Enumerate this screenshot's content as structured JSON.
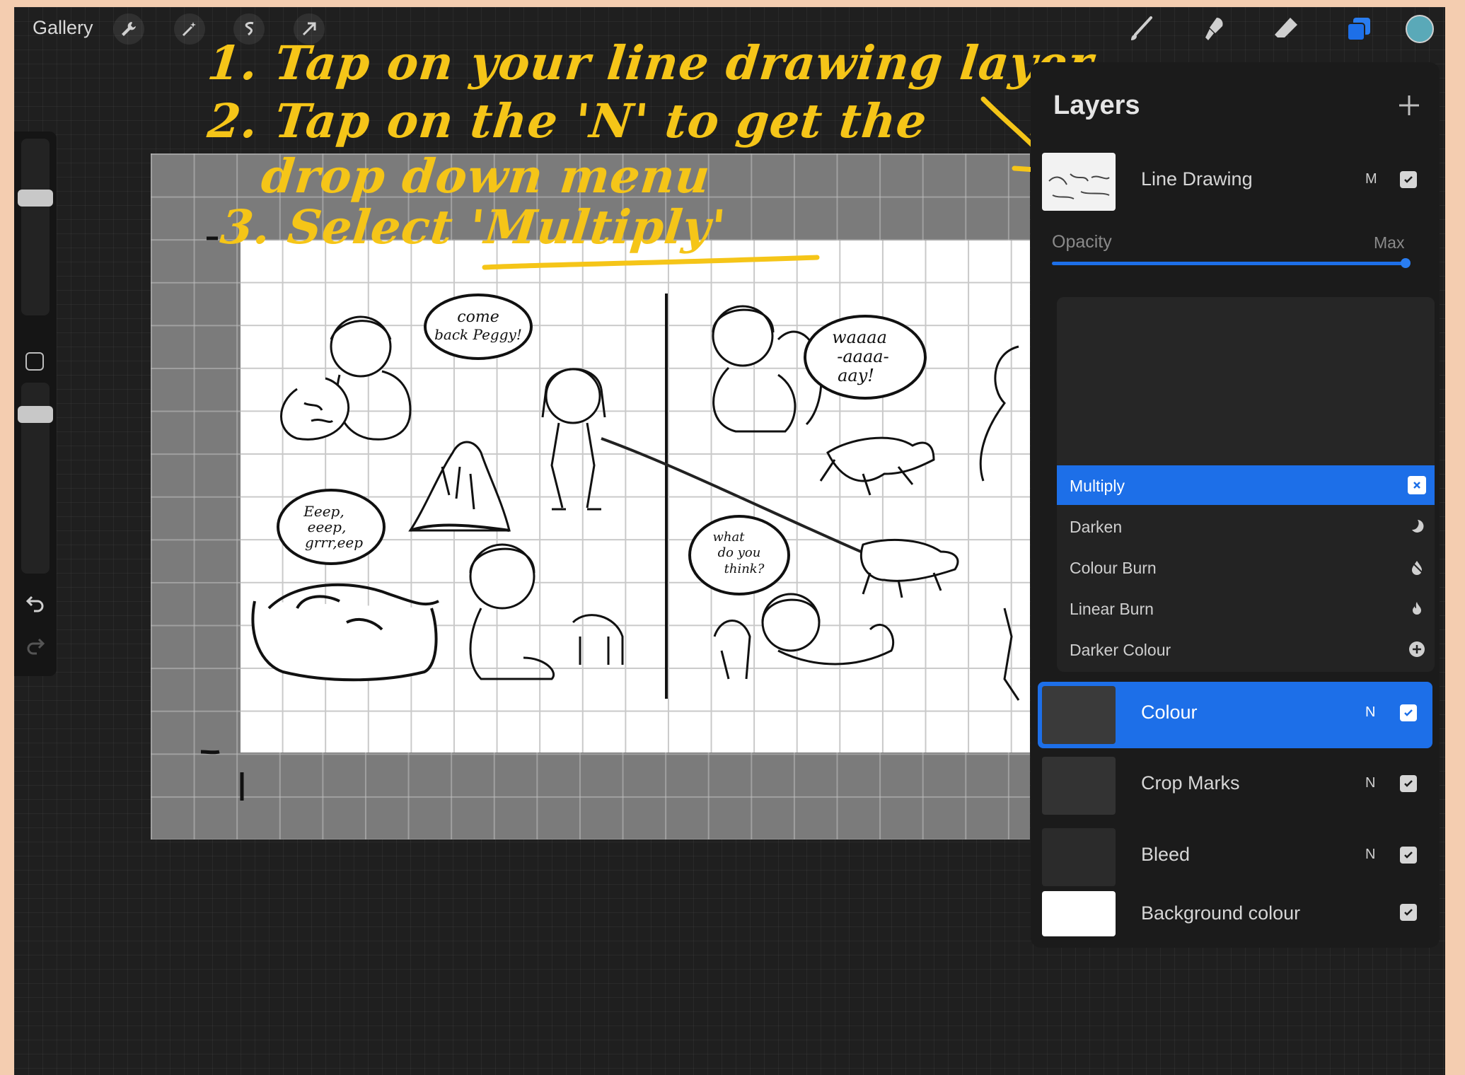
{
  "topbar": {
    "gallery_label": "Gallery",
    "left_tools": [
      "wrench-icon",
      "magic-wand-icon",
      "selection-icon",
      "transform-arrow-icon"
    ],
    "right_tools": [
      "brush-icon",
      "smudge-icon",
      "eraser-icon",
      "layers-icon"
    ],
    "current_color": "#5aa9b8"
  },
  "sidebar": {
    "tools": [
      "brush-size-slider",
      "modify-button",
      "opacity-slider",
      "undo-icon",
      "redo-icon"
    ]
  },
  "annotation": {
    "line1": "1. Tap on your line drawing layer",
    "line2": "2. Tap on the 'N' to get the",
    "line3": "drop down menu",
    "line4": "3. Select 'Multiply'",
    "color": "#f5c518"
  },
  "canvas": {
    "bubbles": [
      "come back Peggy!",
      "Waaaa -aaaa- aay!",
      "Eeep, eeep, grrr, eep",
      "what do you think?"
    ]
  },
  "layers": {
    "title": "Layers",
    "opacity_label": "Opacity",
    "opacity_value": "Max",
    "items": [
      {
        "name": "Line Drawing",
        "mode": "M",
        "visible": true
      },
      {
        "name": "Colour",
        "mode": "N",
        "visible": true
      },
      {
        "name": "Crop Marks",
        "mode": "N",
        "visible": true
      },
      {
        "name": "Bleed",
        "mode": "N",
        "visible": true
      },
      {
        "name": "Background colour",
        "mode": "",
        "visible": true
      }
    ],
    "blend_modes": [
      {
        "label": "Multiply",
        "icon": "multiply-icon",
        "selected": true
      },
      {
        "label": "Darken",
        "icon": "moon-icon",
        "selected": false
      },
      {
        "label": "Colour Burn",
        "icon": "burn-icon",
        "selected": false
      },
      {
        "label": "Linear Burn",
        "icon": "flame-icon",
        "selected": false
      },
      {
        "label": "Darker Colour",
        "icon": "plus-circle-icon",
        "selected": false
      }
    ],
    "accent": "#1d6fe8"
  }
}
